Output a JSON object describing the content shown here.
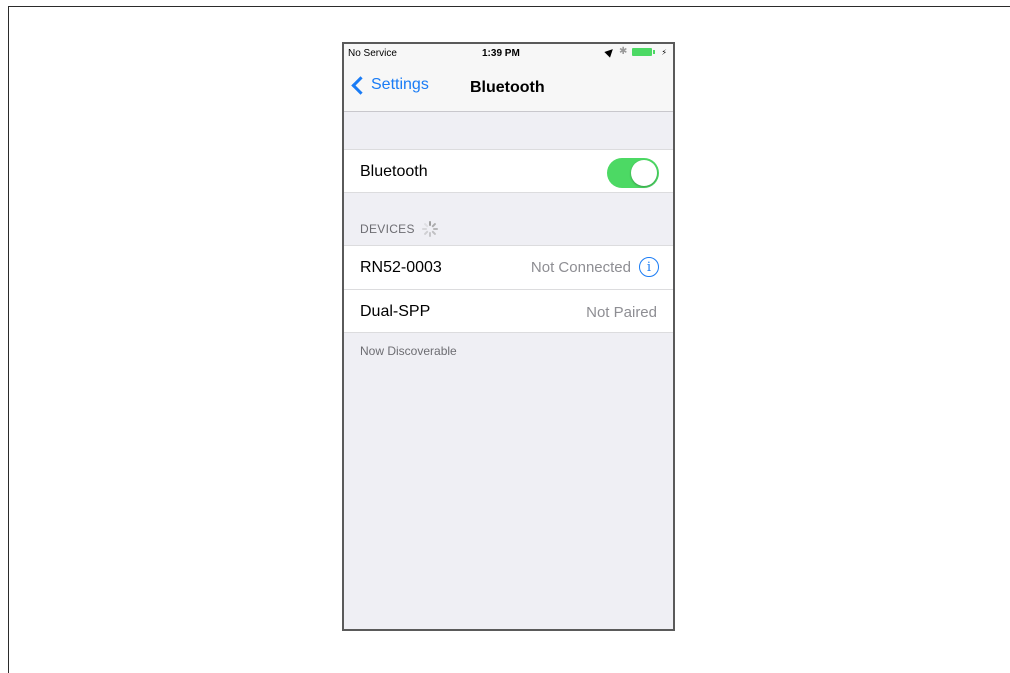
{
  "status_bar": {
    "carrier": "No Service",
    "time": "1:39 PM",
    "bluetooth_symbol": "✱",
    "bolt_symbol": "⚡",
    "icons": [
      "location-arrow-icon",
      "bluetooth-icon",
      "battery-icon",
      "charging-bolt-icon"
    ]
  },
  "nav": {
    "back_label": "Settings",
    "title": "Bluetooth"
  },
  "bluetooth_row": {
    "label": "Bluetooth",
    "toggle_on": true
  },
  "devices_section": {
    "header": "DEVICES",
    "items": [
      {
        "name": "RN52-0003",
        "status": "Not Connected",
        "info_symbol": "i"
      },
      {
        "name": "Dual-SPP",
        "status": "Not Paired"
      }
    ]
  },
  "footer": {
    "text": "Now Discoverable"
  },
  "colors": {
    "accent": "#1a7cf5",
    "toggle_on": "#4cd964",
    "background": "#efeff4",
    "secondary_text": "#8e8e93"
  }
}
